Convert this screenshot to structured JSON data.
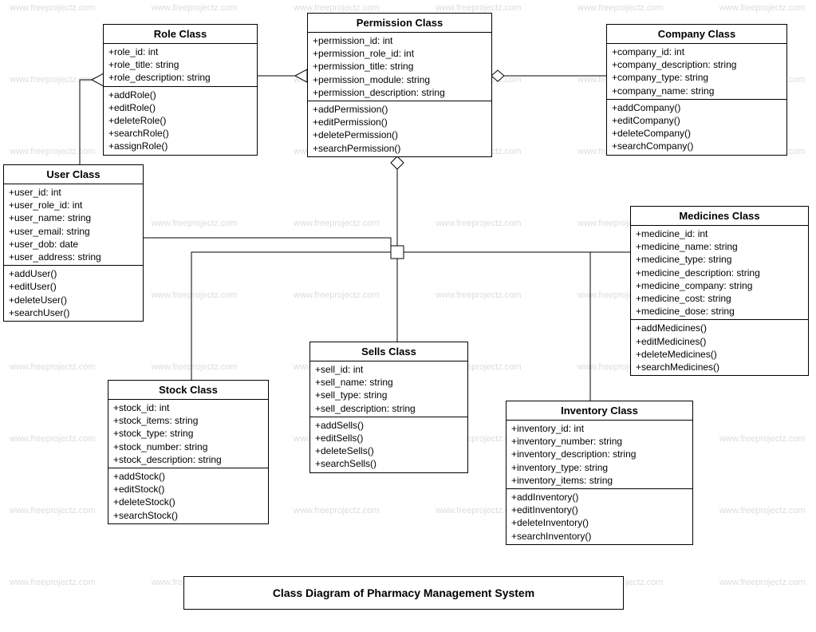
{
  "title": "Class Diagram of Pharmacy Management System",
  "watermark_text": "www.freeprojectz.com",
  "classes": {
    "role": {
      "name": "Role Class",
      "attrs": [
        "+role_id: int",
        "+role_title: string",
        "+role_description: string"
      ],
      "ops": [
        "+addRole()",
        "+editRole()",
        "+deleteRole()",
        "+searchRole()",
        "+assignRole()"
      ]
    },
    "permission": {
      "name": "Permission Class",
      "attrs": [
        "+permission_id: int",
        "+permission_role_id: int",
        "+permission_title: string",
        "+permission_module: string",
        "+permission_description: string"
      ],
      "ops": [
        "+addPermission()",
        "+editPermission()",
        "+deletePermission()",
        "+searchPermission()"
      ]
    },
    "company": {
      "name": "Company Class",
      "attrs": [
        "+company_id: int",
        "+company_description: string",
        "+company_type: string",
        "+company_name: string"
      ],
      "ops": [
        "+addCompany()",
        "+editCompany()",
        "+deleteCompany()",
        "+searchCompany()"
      ]
    },
    "user": {
      "name": "User Class",
      "attrs": [
        "+user_id: int",
        "+user_role_id: int",
        "+user_name: string",
        "+user_email: string",
        "+user_dob: date",
        "+user_address: string"
      ],
      "ops": [
        "+addUser()",
        "+editUser()",
        "+deleteUser()",
        "+searchUser()"
      ]
    },
    "medicines": {
      "name": "Medicines Class",
      "attrs": [
        "+medicine_id: int",
        "+medicine_name: string",
        "+medicine_type: string",
        "+medicine_description: string",
        "+medicine_company: string",
        "+medicine_cost: string",
        "+medicine_dose: string"
      ],
      "ops": [
        "+addMedicines()",
        "+editMedicines()",
        "+deleteMedicines()",
        "+searchMedicines()"
      ]
    },
    "sells": {
      "name": "Sells Class",
      "attrs": [
        "+sell_id: int",
        "+sell_name: string",
        "+sell_type: string",
        "+sell_description: string"
      ],
      "ops": [
        "+addSells()",
        "+editSells()",
        "+deleteSells()",
        "+searchSells()"
      ]
    },
    "stock": {
      "name": "Stock Class",
      "attrs": [
        "+stock_id: int",
        "+stock_items: string",
        "+stock_type: string",
        "+stock_number: string",
        "+stock_description: string"
      ],
      "ops": [
        "+addStock()",
        "+editStock()",
        "+deleteStock()",
        "+searchStock()"
      ]
    },
    "inventory": {
      "name": "Inventory Class",
      "attrs": [
        "+inventory_id: int",
        "+inventory_number: string",
        "+inventory_description: string",
        "+inventory_type: string",
        "+inventory_items: string"
      ],
      "ops": [
        "+addInventory()",
        "+editInventory()",
        "+deleteInventory()",
        "+searchInventory()"
      ]
    }
  }
}
